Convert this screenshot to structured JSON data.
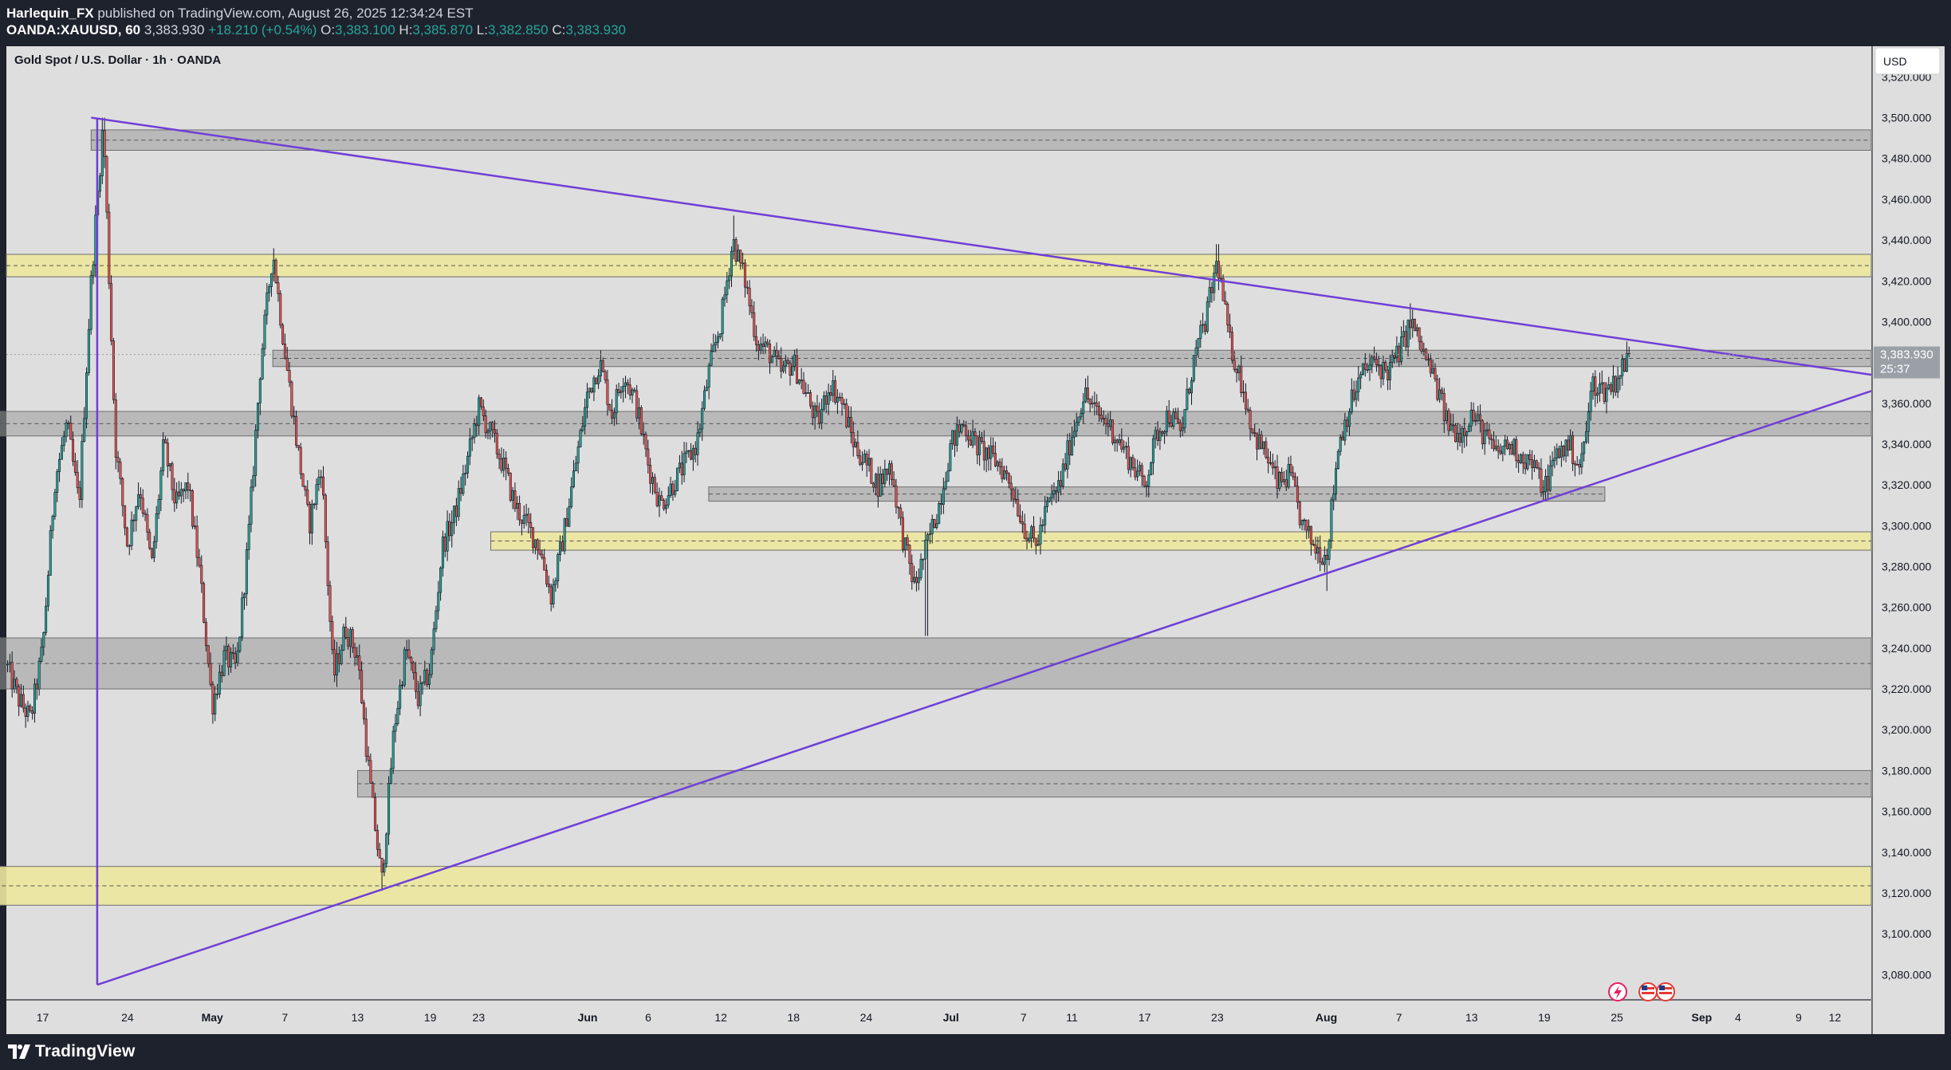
{
  "header": {
    "author": "Harlequin_FX",
    "published_text": " published on TradingView.com, August 26, 2025 12:34:24 EST",
    "symbol": "OANDA:XAUUSD, 60",
    "last": "3,383.930",
    "change": "+18.210 (+0.54%)",
    "o_label": "O:",
    "o_value": "3,383.100",
    "h_label": "H:",
    "h_value": "3,385.870",
    "l_label": "L:",
    "l_value": "3,382.850",
    "c_label": "C:",
    "c_value": "3,383.930"
  },
  "chart": {
    "title": "Gold Spot / U.S. Dollar · 1h · OANDA",
    "currency": "USD",
    "last_price_label": "3,383.930",
    "countdown": "25:37",
    "background": "#dedede",
    "candle_up": "#26a69a",
    "candle_down": "#ef5350",
    "trendline_color": "#6f3fd6",
    "gray_zone_color": "#9a9a9a",
    "yellow_zone_color": "#ede79e"
  },
  "footer": {
    "brand": "TradingView"
  },
  "chart_data": {
    "type": "candlestick",
    "title": "Gold Spot / U.S. Dollar · 1h · OANDA",
    "ylabel": "USD",
    "ylim": [
      3068,
      3535
    ],
    "y_ticks": [
      "3,080.000",
      "3,100.000",
      "3,120.000",
      "3,140.000",
      "3,160.000",
      "3,180.000",
      "3,200.000",
      "3,220.000",
      "3,240.000",
      "3,260.000",
      "3,280.000",
      "3,300.000",
      "3,320.000",
      "3,340.000",
      "3,360.000",
      "3,380.000",
      "3,400.000",
      "3,420.000",
      "3,440.000",
      "3,460.000",
      "3,480.000",
      "3,500.000",
      "3,520.000"
    ],
    "x_ticks": [
      {
        "label": "17",
        "day": 17
      },
      {
        "label": "24",
        "day": 24
      },
      {
        "label": "May",
        "day": 31
      },
      {
        "label": "7",
        "day": 37
      },
      {
        "label": "13",
        "day": 43
      },
      {
        "label": "19",
        "day": 49
      },
      {
        "label": "23",
        "day": 53
      },
      {
        "label": "Jun",
        "day": 62
      },
      {
        "label": "6",
        "day": 67
      },
      {
        "label": "12",
        "day": 73
      },
      {
        "label": "18",
        "day": 79
      },
      {
        "label": "24",
        "day": 85
      },
      {
        "label": "Jul",
        "day": 92
      },
      {
        "label": "7",
        "day": 98
      },
      {
        "label": "11",
        "day": 102
      },
      {
        "label": "17",
        "day": 108
      },
      {
        "label": "23",
        "day": 114
      },
      {
        "label": "Aug",
        "day": 123
      },
      {
        "label": "7",
        "day": 129
      },
      {
        "label": "13",
        "day": 135
      },
      {
        "label": "19",
        "day": 141
      },
      {
        "label": "25",
        "day": 147
      },
      {
        "label": "Sep",
        "day": 154
      },
      {
        "label": "4",
        "day": 157
      },
      {
        "label": "9",
        "day": 162
      },
      {
        "label": "12",
        "day": 165
      }
    ],
    "price_path": [
      [
        "2025-04-14",
        3232
      ],
      [
        "2025-04-15",
        3215
      ],
      [
        "2025-04-16",
        3205
      ],
      [
        "2025-04-17",
        3240
      ],
      [
        "2025-04-18",
        3322
      ],
      [
        "2025-04-19",
        3350
      ],
      [
        "2025-04-20",
        3310
      ],
      [
        "2025-04-21",
        3420
      ],
      [
        "2025-04-22",
        3498
      ],
      [
        "2025-04-23",
        3340
      ],
      [
        "2025-04-24",
        3290
      ],
      [
        "2025-04-25",
        3320
      ],
      [
        "2025-04-26",
        3280
      ],
      [
        "2025-04-27",
        3340
      ],
      [
        "2025-04-28",
        3310
      ],
      [
        "2025-04-29",
        3320
      ],
      [
        "2025-04-30",
        3275
      ],
      [
        "2025-05-01",
        3212
      ],
      [
        "2025-05-02",
        3236
      ],
      [
        "2025-05-03",
        3230
      ],
      [
        "2025-05-04",
        3295
      ],
      [
        "2025-05-05",
        3380
      ],
      [
        "2025-05-06",
        3435
      ],
      [
        "2025-05-07",
        3385
      ],
      [
        "2025-05-08",
        3340
      ],
      [
        "2025-05-09",
        3300
      ],
      [
        "2025-05-10",
        3330
      ],
      [
        "2025-05-11",
        3225
      ],
      [
        "2025-05-12",
        3250
      ],
      [
        "2025-05-13",
        3236
      ],
      [
        "2025-05-14",
        3175
      ],
      [
        "2025-05-15",
        3125
      ],
      [
        "2025-05-16",
        3200
      ],
      [
        "2025-05-17",
        3240
      ],
      [
        "2025-05-18",
        3215
      ],
      [
        "2025-05-19",
        3230
      ],
      [
        "2025-05-20",
        3290
      ],
      [
        "2025-05-21",
        3305
      ],
      [
        "2025-05-22",
        3330
      ],
      [
        "2025-05-23",
        3358
      ],
      [
        "2025-05-24",
        3345
      ],
      [
        "2025-05-25",
        3330
      ],
      [
        "2025-05-26",
        3310
      ],
      [
        "2025-05-27",
        3300
      ],
      [
        "2025-05-28",
        3290
      ],
      [
        "2025-05-29",
        3265
      ],
      [
        "2025-05-30",
        3295
      ],
      [
        "2025-05-31",
        3330
      ],
      [
        "2025-06-01",
        3365
      ],
      [
        "2025-06-02",
        3380
      ],
      [
        "2025-06-03",
        3355
      ],
      [
        "2025-06-04",
        3375
      ],
      [
        "2025-06-05",
        3360
      ],
      [
        "2025-06-06",
        3330
      ],
      [
        "2025-06-07",
        3310
      ],
      [
        "2025-06-08",
        3320
      ],
      [
        "2025-06-09",
        3330
      ],
      [
        "2025-06-10",
        3340
      ],
      [
        "2025-06-11",
        3375
      ],
      [
        "2025-06-12",
        3400
      ],
      [
        "2025-06-13",
        3440
      ],
      [
        "2025-06-14",
        3420
      ],
      [
        "2025-06-15",
        3390
      ],
      [
        "2025-06-16",
        3385
      ],
      [
        "2025-06-17",
        3375
      ],
      [
        "2025-06-18",
        3380
      ],
      [
        "2025-06-19",
        3365
      ],
      [
        "2025-06-20",
        3350
      ],
      [
        "2025-06-21",
        3370
      ],
      [
        "2025-06-22",
        3360
      ],
      [
        "2025-06-23",
        3340
      ],
      [
        "2025-06-24",
        3330
      ],
      [
        "2025-06-25",
        3320
      ],
      [
        "2025-06-26",
        3330
      ],
      [
        "2025-06-27",
        3295
      ],
      [
        "2025-06-28",
        3270
      ],
      [
        "2025-06-29",
        3290
      ],
      [
        "2025-06-30",
        3310
      ],
      [
        "2025-07-01",
        3340
      ],
      [
        "2025-07-02",
        3350
      ],
      [
        "2025-07-03",
        3340
      ],
      [
        "2025-07-04",
        3335
      ],
      [
        "2025-07-05",
        3330
      ],
      [
        "2025-07-06",
        3320
      ],
      [
        "2025-07-07",
        3300
      ],
      [
        "2025-07-08",
        3290
      ],
      [
        "2025-07-09",
        3310
      ],
      [
        "2025-07-10",
        3320
      ],
      [
        "2025-07-11",
        3345
      ],
      [
        "2025-07-12",
        3365
      ],
      [
        "2025-07-13",
        3355
      ],
      [
        "2025-07-14",
        3350
      ],
      [
        "2025-07-15",
        3340
      ],
      [
        "2025-07-16",
        3330
      ],
      [
        "2025-07-17",
        3320
      ],
      [
        "2025-07-18",
        3345
      ],
      [
        "2025-07-19",
        3355
      ],
      [
        "2025-07-20",
        3345
      ],
      [
        "2025-07-21",
        3380
      ],
      [
        "2025-07-22",
        3400
      ],
      [
        "2025-07-23",
        3430
      ],
      [
        "2025-07-24",
        3390
      ],
      [
        "2025-07-25",
        3370
      ],
      [
        "2025-07-26",
        3345
      ],
      [
        "2025-07-27",
        3335
      ],
      [
        "2025-07-28",
        3320
      ],
      [
        "2025-07-29",
        3325
      ],
      [
        "2025-07-30",
        3300
      ],
      [
        "2025-07-31",
        3290
      ],
      [
        "2025-08-01",
        3285
      ],
      [
        "2025-08-02",
        3340
      ],
      [
        "2025-08-03",
        3360
      ],
      [
        "2025-08-04",
        3375
      ],
      [
        "2025-08-05",
        3380
      ],
      [
        "2025-08-06",
        3375
      ],
      [
        "2025-08-07",
        3385
      ],
      [
        "2025-08-08",
        3400
      ],
      [
        "2025-08-09",
        3385
      ],
      [
        "2025-08-10",
        3370
      ],
      [
        "2025-08-11",
        3350
      ],
      [
        "2025-08-12",
        3345
      ],
      [
        "2025-08-13",
        3355
      ],
      [
        "2025-08-14",
        3345
      ],
      [
        "2025-08-15",
        3335
      ],
      [
        "2025-08-16",
        3340
      ],
      [
        "2025-08-17",
        3335
      ],
      [
        "2025-08-18",
        3330
      ],
      [
        "2025-08-19",
        3318
      ],
      [
        "2025-08-20",
        3335
      ],
      [
        "2025-08-21",
        3340
      ],
      [
        "2025-08-22",
        3328
      ],
      [
        "2025-08-23",
        3370
      ],
      [
        "2025-08-24",
        3366
      ],
      [
        "2025-08-25",
        3372
      ],
      [
        "2025-08-26",
        3383.93
      ]
    ],
    "extremes": [
      [
        "2025-04-22",
        3500
      ],
      [
        "2025-05-06",
        3436
      ],
      [
        "2025-05-15",
        3121
      ],
      [
        "2025-06-13",
        3452
      ],
      [
        "2025-07-23",
        3438
      ],
      [
        "2025-08-01",
        3268
      ],
      [
        "2025-08-08",
        3409
      ],
      [
        "2025-08-19",
        3312
      ],
      [
        "2025-06-29",
        3246
      ]
    ],
    "zones": [
      {
        "kind": "gray",
        "from": 3484,
        "to": 3494,
        "start_day": 21
      },
      {
        "kind": "yellow",
        "from": 3422,
        "to": 3433,
        "start_day": 14
      },
      {
        "kind": "gray",
        "from": 3378,
        "to": 3386,
        "start_day": 36
      },
      {
        "kind": "gray",
        "from": 3344,
        "to": 3356,
        "start_day": 11
      },
      {
        "kind": "gray",
        "from": 3312,
        "to": 3319,
        "start_day": 72,
        "end_day": 146
      },
      {
        "kind": "yellow",
        "from": 3288,
        "to": 3297,
        "start_day": 54
      },
      {
        "kind": "gray",
        "from": 3220,
        "to": 3245,
        "start_day": 0
      },
      {
        "kind": "gray",
        "from": 3167,
        "to": 3180,
        "start_day": 43
      },
      {
        "kind": "yellow",
        "from": 3114,
        "to": 3133,
        "start_day": 0
      }
    ],
    "trendlines": [
      {
        "from": [
          21,
          3500
        ],
        "to": [
          168,
          3374
        ]
      },
      {
        "from": [
          21.5,
          3500
        ],
        "to": [
          21.5,
          3075
        ]
      },
      {
        "from": [
          21.5,
          3075
        ],
        "to": [
          168,
          3366
        ]
      }
    ],
    "last_price": 3383.93
  }
}
